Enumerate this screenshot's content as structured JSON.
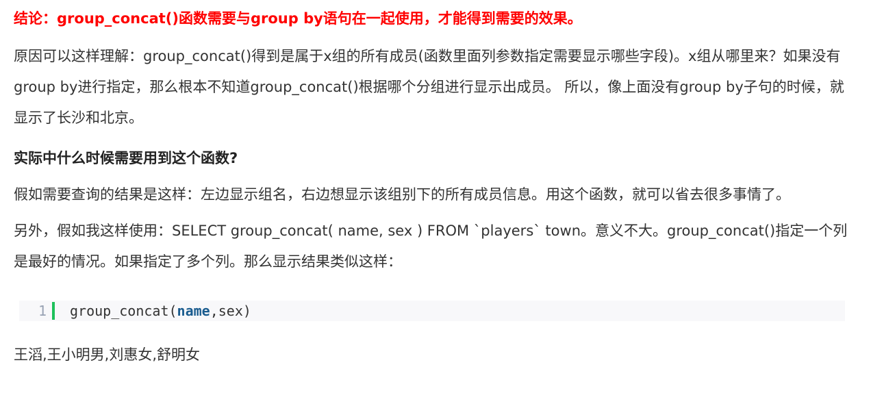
{
  "conclusion": "结论：group_concat()函数需要与group by语句在一起使用，才能得到需要的效果。",
  "paragraph1": "原因可以这样理解：group_concat()得到是属于x组的所有成员(函数里面列参数指定需要显示哪些字段)。x组从哪里来？如果没有group by进行指定，那么根本不知道group_concat()根据哪个分组进行显示出成员。 所以，像上面没有group by子句的时候，就显示了长沙和北京。",
  "heading": "实际中什么时候需要用到这个函数?",
  "paragraph2": "假如需要查询的结果是这样：左边显示组名，右边想显示该组别下的所有成员信息。用这个函数，就可以省去很多事情了。",
  "paragraph3": "另外，假如我这样使用：SELECT group_concat( name, sex ) FROM `players` town。意义不大。group_concat()指定一个列是最好的情况。如果指定了多个列。那么显示结果类似这样：",
  "code": {
    "line_number": "1",
    "prefix": "group_concat(",
    "keyword": "name",
    "suffix": ",sex)"
  },
  "result": "王滔,王小明男,刘惠女,舒明女"
}
